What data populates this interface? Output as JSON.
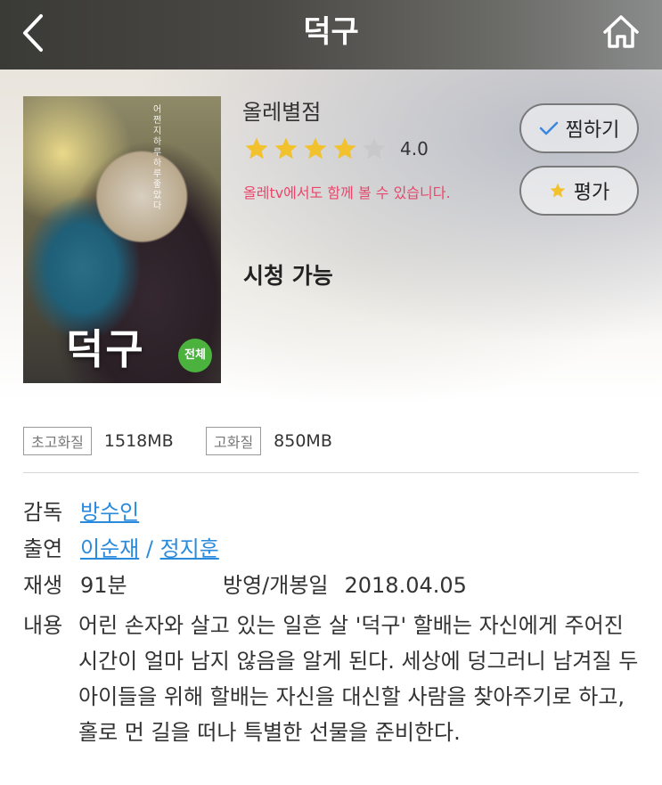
{
  "header": {
    "title": "덕구",
    "back_icon": "chevron-left-icon",
    "home_icon": "home-icon"
  },
  "poster": {
    "title_text": "덕구",
    "badge": "전체",
    "tagline": "어쩐지 하루하루 좋았다"
  },
  "rating": {
    "label": "올레별점",
    "value": "4.0",
    "stars_filled": 4,
    "stars_total": 5,
    "star_color": "#f2c12e",
    "star_empty_color": "#c8c8c8"
  },
  "note": "올레tv에서도 함께 볼 수 있습니다.",
  "availability": "시청 가능",
  "actions": {
    "wish_label": "찜하기",
    "rate_label": "평가"
  },
  "quality": [
    {
      "tag": "초고화질",
      "size": "1518MB"
    },
    {
      "tag": "고화질",
      "size": "850MB"
    }
  ],
  "details": {
    "director_label": "감독",
    "director": "방수인",
    "cast_label": "출연",
    "cast": [
      "이순재",
      "정지훈"
    ],
    "cast_sep": " / ",
    "runtime_label": "재생",
    "runtime": "91분",
    "release_label": "방영/개봉일",
    "release_date": "2018.04.05",
    "synopsis_label": "내용",
    "synopsis": "어린 손자와 살고 있는 일흔 살 '덕구' 할배는 자신에게 주어진 시간이 얼마 남지 않음을 알게 된다. 세상에 덩그러니 남겨질 두 아이들을 위해 할배는 자신을 대신할 사람을 찾아주기로 하고, 홀로 먼 길을 떠나 특별한 선물을 준비한다."
  },
  "colors": {
    "accent_link": "#2a8adc",
    "note_pink": "#e8476b",
    "check_blue": "#3a86e0"
  }
}
